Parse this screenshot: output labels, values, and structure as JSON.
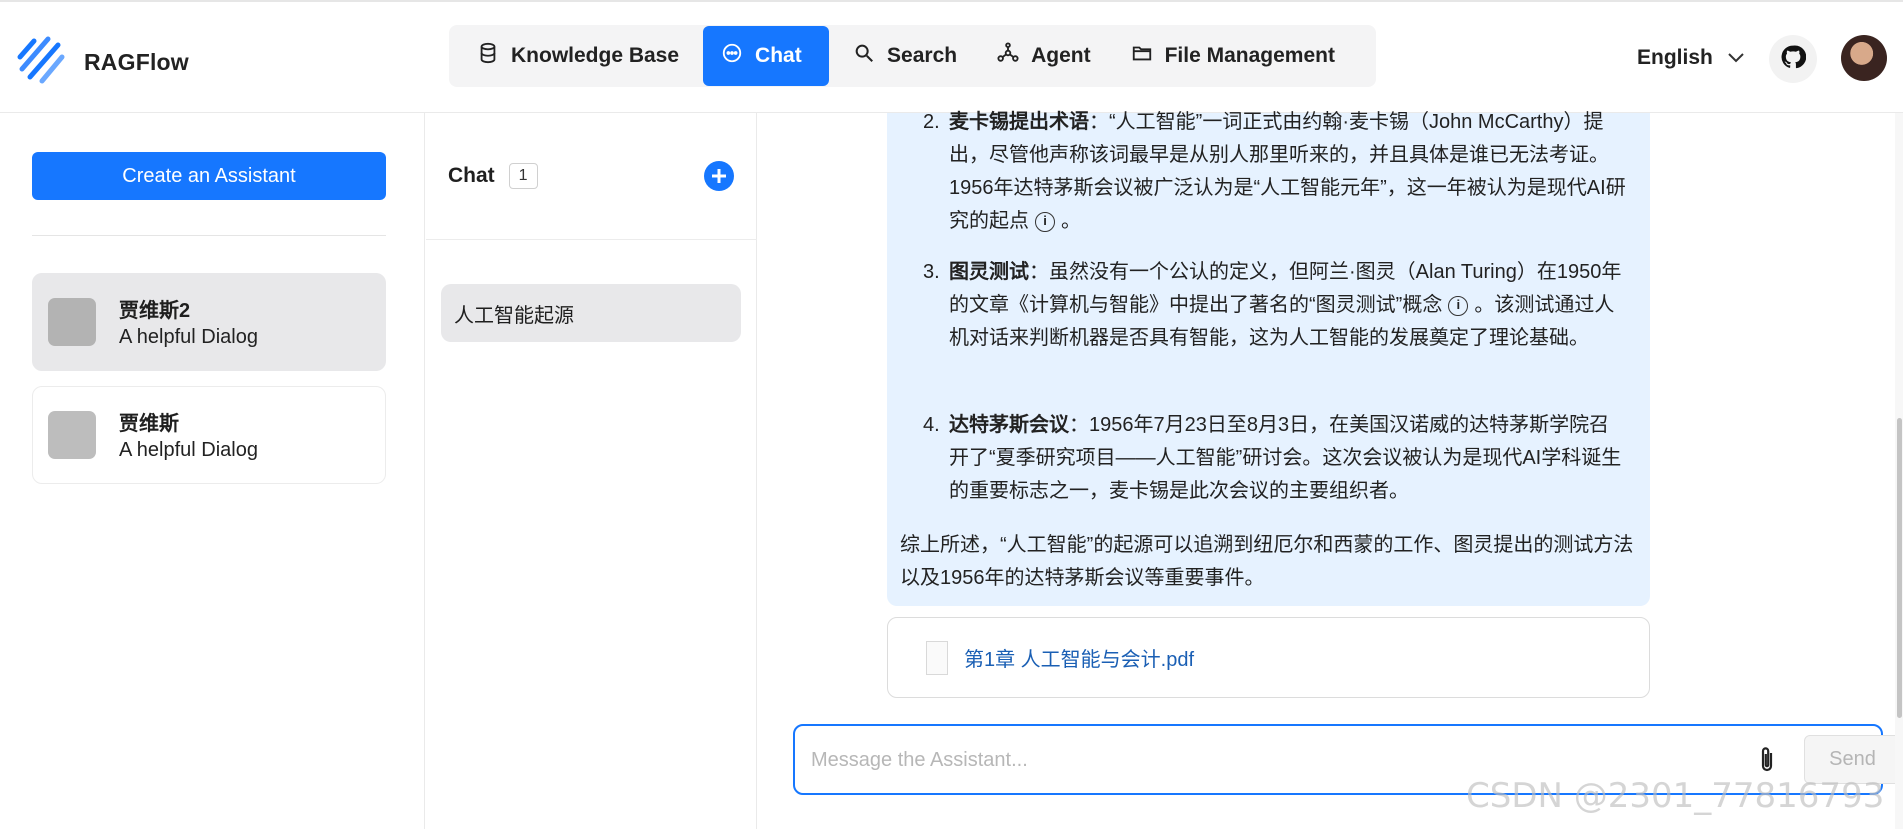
{
  "app": {
    "name": "RAGFlow",
    "accent": "#1677ff"
  },
  "nav": {
    "items": [
      {
        "label": "Knowledge Base",
        "icon": "database-icon"
      },
      {
        "label": "Chat",
        "icon": "chat-bubble-icon",
        "active": true
      },
      {
        "label": "Search",
        "icon": "search-icon"
      },
      {
        "label": "Agent",
        "icon": "agent-graph-icon"
      },
      {
        "label": "File Management",
        "icon": "folder-icon"
      }
    ]
  },
  "header": {
    "language": "English"
  },
  "assistants": {
    "create_label": "Create an Assistant",
    "items": [
      {
        "name": "贾维斯2",
        "description": "A helpful Dialog",
        "selected": true
      },
      {
        "name": "贾维斯",
        "description": "A helpful Dialog",
        "selected": false
      }
    ]
  },
  "conversations": {
    "title": "Chat",
    "count": "1",
    "items": [
      {
        "title": "人工智能起源"
      }
    ]
  },
  "message": {
    "items": [
      {
        "num": "2.",
        "title": "麦卡锡提出术语",
        "text": "：“人工智能”一词正式由约翰·麦卡锡（John McCarthy）提出，尽管他声称该词最早是从别人那里听来的，并且具体是谁已无法考证。1956年达特茅斯会议被广泛认为是“人工智能元年”，这一年被认为是现代AI研究的起点",
        "tail": "。"
      },
      {
        "num": "3.",
        "title": "图灵测试",
        "text": "：虽然没有一个公认的定义，但阿兰·图灵（Alan Turing）在1950年的文章《计算机与智能》中提出了著名的“图灵测试”概念",
        "tail": "。该测试通过人机对话来判断机器是否具有智能，这为人工智能的发展奠定了理论基础。"
      },
      {
        "num": "4.",
        "title": "达特茅斯会议",
        "text": "：1956年7月23日至8月3日，在美国汉诺威的达特茅斯学院召开了“夏季研究项目——人工智能”研讨会。这次会议被认为是现代AI学科诞生的重要标志之一，麦卡锡是此次会议的主要组织者。",
        "tail": ""
      }
    ],
    "cite_glyph": "i",
    "summary": "综上所述，“人工智能”的起源可以追溯到纽厄尔和西蒙的工作、图灵提出的测试方法以及1956年的达特茅斯会议等重要事件。",
    "document": "第1章 人工智能与会计.pdf"
  },
  "composer": {
    "placeholder": "Message the Assistant...",
    "send_label": "Send"
  },
  "watermark": "CSDN @2301_77816793"
}
